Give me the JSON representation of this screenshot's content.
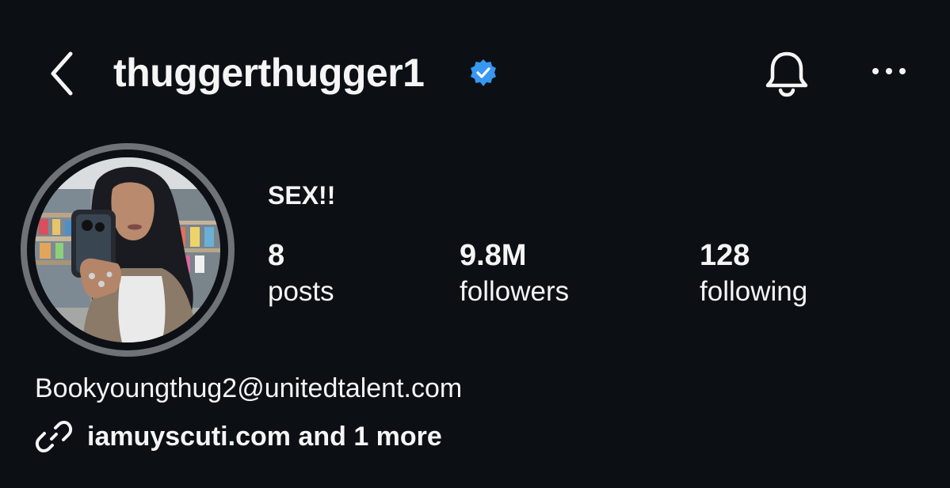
{
  "header": {
    "back_icon": "chevron-left-icon",
    "username": "thuggerthugger1",
    "verified_icon": "verified-badge-icon",
    "bell_icon": "bell-icon",
    "more_icon": "more-horizontal-icon"
  },
  "profile": {
    "display_name": "SEX!!",
    "stats": [
      {
        "value": "8",
        "label": "posts"
      },
      {
        "value": "9.8M",
        "label": "followers"
      },
      {
        "value": "128",
        "label": "following"
      }
    ],
    "email": "Bookyoungthug2@unitedtalent.com",
    "link_icon": "link-icon",
    "link_text": "iamuyscuti.com and 1 more"
  },
  "colors": {
    "background": "#0c1014",
    "text": "#f5f5f5",
    "verified": "#3897f0",
    "avatar_ring": "#6f7377"
  }
}
